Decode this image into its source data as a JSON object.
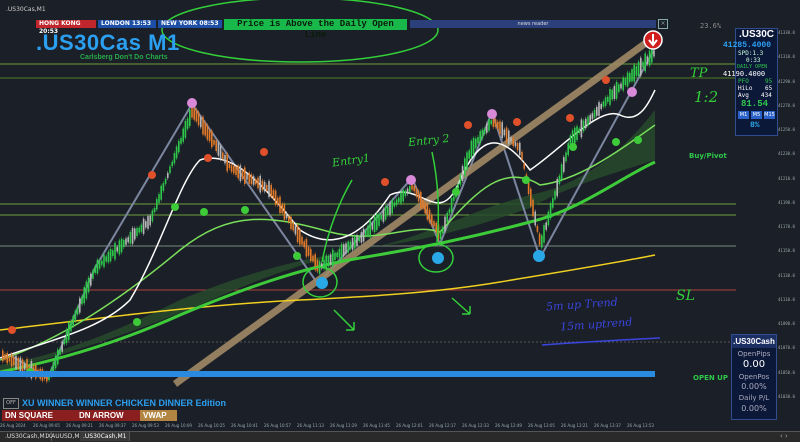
{
  "window": {
    "title": ".US30Cas,M1"
  },
  "sessions": [
    {
      "label": "HONG KONG",
      "time": "20:53",
      "color": "#c0262b"
    },
    {
      "label": "LONDON",
      "time": "13:53",
      "color": "#1d4fa6"
    },
    {
      "label": "NEW YORK",
      "time": "08:53",
      "color": "#1d4fa6"
    }
  ],
  "banner": {
    "text": "Price is Above the Daily Open Line",
    "color": "#19b84b"
  },
  "news_label": "news reader",
  "top_percent": "23.6%",
  "symbol_title": ".US30Cas M1",
  "subtitle": "Carlsberg Don't Do Charts",
  "info_panel": {
    "symbol": ".US30C",
    "price": "41285.4000",
    "spd": "SPD:1.3",
    "time": "0:33",
    "daily_open_label": "DAILY OPEN",
    "daily_open": "41190.4000",
    "pfo_label": "PFO",
    "pfo": "95",
    "hilo_label": "HiLo",
    "hilo": "65",
    "avg_label": "Avg",
    "avg": "434",
    "pips": "81.54",
    "tf_buttons": [
      "M1",
      "M5",
      "M15"
    ],
    "pct": "8%"
  },
  "side_labels": {
    "buy_pivot": "Buy/Pivot",
    "open_up": "OPEN UP"
  },
  "annotations": {
    "tp": "TP",
    "ratio": "1:2",
    "entry1": "Entry1",
    "entry2": "Entry 2",
    "sl": "SL",
    "trend_note_1": "5m up Trend",
    "trend_note_2": "15m uptrend"
  },
  "cash_panel": {
    "title": ".US30Cash",
    "open_pips_label": "OpenPips",
    "open_pips": "0.00",
    "open_pos_label": "OpenPos",
    "open_pos": "0.00%",
    "daily_pl_label": "Daily P/L",
    "daily_pl": "0.00%"
  },
  "bottom": {
    "off": "OFF",
    "edition": "XU WINNER WINNER CHICKEN DINNER Edition",
    "buttons": [
      "DN SQUARE",
      "DN ARROW",
      "VWAP"
    ]
  },
  "price_axis": [
    "41330.0",
    "41310.0",
    "41290.0",
    "41270.0",
    "41250.0",
    "41230.0",
    "41210.0",
    "41190.0",
    "41170.0",
    "41150.0",
    "41130.0",
    "41110.0",
    "41090.0",
    "41070.0",
    "41050.0",
    "41030.0"
  ],
  "time_axis": [
    "26 Aug 2024",
    "26 Aug 09:05",
    "26 Aug 09:21",
    "26 Aug 09:37",
    "26 Aug 09:53",
    "26 Aug 10:09",
    "26 Aug 10:25",
    "26 Aug 10:41",
    "26 Aug 10:57",
    "26 Aug 11:13",
    "26 Aug 11:29",
    "26 Aug 11:45",
    "26 Aug 12:01",
    "26 Aug 12:17",
    "26 Aug 12:33",
    "26 Aug 12:49",
    "26 Aug 13:05",
    "26 Aug 13:21",
    "26 Aug 13:37",
    "26 Aug 13:53"
  ],
  "tabs": [
    ".US30Cash,M1",
    "XAUUSD,M1",
    ".US30Cash,M1"
  ],
  "colors": {
    "bg": "#1b1f27",
    "bull": "#2ec84a",
    "bear": "#e07a2a",
    "neutral": "#b8b8b8",
    "trend_line": "#a08a66"
  }
}
